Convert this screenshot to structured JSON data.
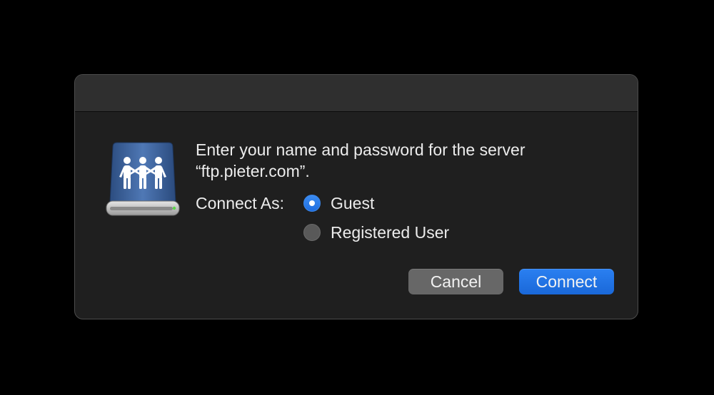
{
  "dialog": {
    "icon": "shared-server-icon",
    "message_line1": "Enter your name and password for the server",
    "message_line2": "“ftp.pieter.com”.",
    "connect_as_label": "Connect As:",
    "options": [
      {
        "label": "Guest",
        "selected": true
      },
      {
        "label": "Registered User",
        "selected": false
      }
    ],
    "buttons": {
      "cancel_label": "Cancel",
      "connect_label": "Connect"
    }
  },
  "colors": {
    "accent": "#1f6ee0",
    "background": "#1f1f1f",
    "titlebar": "#2f2f2f"
  }
}
